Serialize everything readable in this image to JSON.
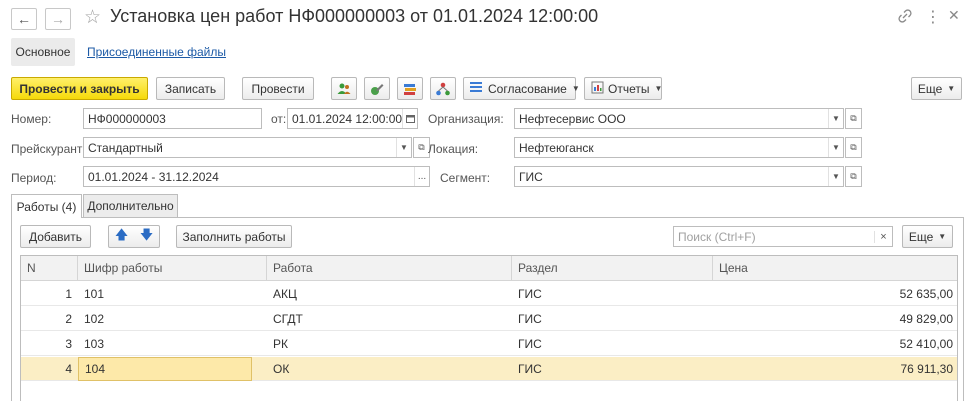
{
  "window": {
    "title": "Установка цен работ НФ000000003 от 01.01.2024 12:00:00"
  },
  "sections": {
    "main": "Основное",
    "attached": "Присоединенные файлы"
  },
  "toolbar": {
    "post_close": "Провести и закрыть",
    "save": "Записать",
    "post": "Провести",
    "approval": "Согласование",
    "reports": "Отчеты",
    "more": "Еще"
  },
  "form": {
    "number_label": "Номер:",
    "number_value": "НФ000000003",
    "date_label": "от:",
    "date_value": "01.01.2024 12:00:00",
    "org_label": "Организация:",
    "org_value": "Нефтесервис ООО",
    "pricelist_label": "Прейскурант:",
    "pricelist_value": "Стандартный",
    "location_label": "Локация:",
    "location_value": "Нефтеюганск",
    "period_label": "Период:",
    "period_value": "01.01.2024 - 31.12.2024",
    "period_btn": "...",
    "segment_label": "Сегмент:",
    "segment_value": "ГИС"
  },
  "tabs": [
    {
      "label": "Работы (4)",
      "active": true
    },
    {
      "label": "Дополнительно",
      "active": false
    }
  ],
  "table_toolbar": {
    "add": "Добавить",
    "fill": "Заполнить работы",
    "search_placeholder": "Поиск (Ctrl+F)",
    "clear": "×",
    "more": "Еще"
  },
  "table": {
    "columns": [
      "N",
      "Шифр работы",
      "Работа",
      "Раздел",
      "Цена"
    ],
    "rows": [
      {
        "n": "1",
        "code": "101",
        "work": "АКЦ",
        "section": "ГИС",
        "price": "52 635,00"
      },
      {
        "n": "2",
        "code": "102",
        "work": "СГДТ",
        "section": "ГИС",
        "price": "49 829,00"
      },
      {
        "n": "3",
        "code": "103",
        "work": "РК",
        "section": "ГИС",
        "price": "52 410,00"
      },
      {
        "n": "4",
        "code": "104",
        "work": "ОК",
        "section": "ГИС",
        "price": "76 911,30"
      }
    ],
    "selected_row": 3
  },
  "colors": {
    "primary_button": "#f6d90a",
    "link": "#1c5aa6",
    "selected_row": "#fbeec5"
  }
}
